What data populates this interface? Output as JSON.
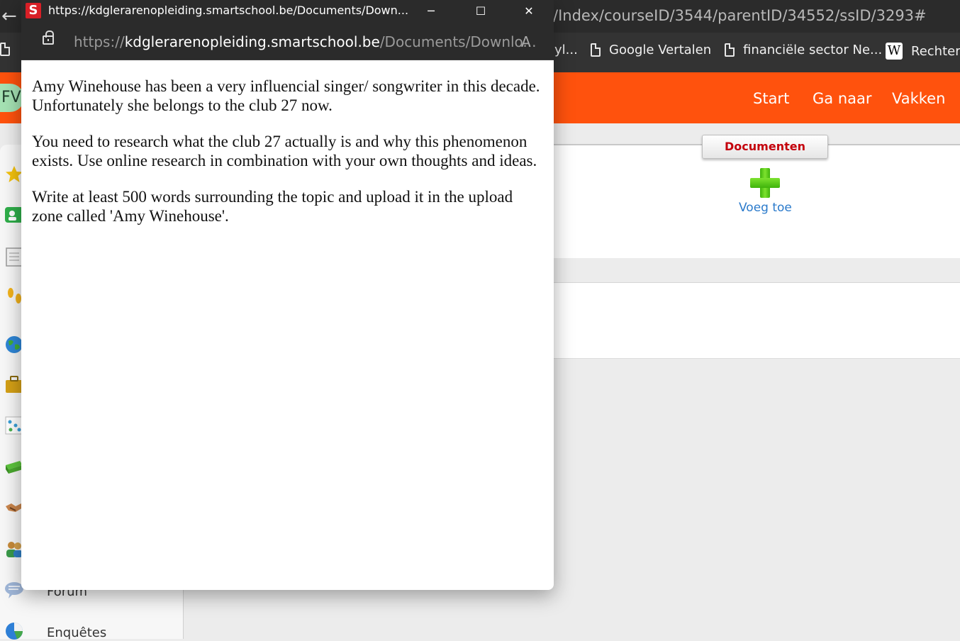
{
  "background": {
    "url_fragment": "/Index/courseID/3544/parentID/34552/ssID/3293#",
    "favorites": [
      {
        "label": "yl...",
        "icon": "document-icon"
      },
      {
        "label": "Google Vertalen",
        "icon": "document-icon"
      },
      {
        "label": "financiële sector Ne...",
        "icon": "document-icon"
      },
      {
        "label": "Rechterli",
        "icon": "wikipedia-icon"
      }
    ],
    "avatar_initials": "FV",
    "nav": {
      "start": "Start",
      "ga_naar": "Ga naar",
      "vakken": "Vakken"
    },
    "documents_tab": "Documenten",
    "add_label": "Voeg toe",
    "sidebar": {
      "forum": "Forum",
      "enquetes": "Enquêtes"
    },
    "colors": {
      "brand_orange": "#ff520d",
      "tab_red": "#c4000c",
      "link_blue": "#2a7acb"
    }
  },
  "popup": {
    "favicon_letter": "S",
    "title": "https://kdglerarenopleiding.smartschool.be/Documents/Down...",
    "url_scheme": "https://",
    "url_host": "kdglerarenopleiding.smartschool.be",
    "url_path": "/Documents/Downlo...",
    "read_aloud_glyph": "A",
    "window_buttons": {
      "minimize": "─",
      "maximize": "☐",
      "close": "✕"
    },
    "paragraphs": [
      "Amy Winehouse has been a very influencial singer/ songwriter in this decade. Unfortunately she belongs to the club 27 now.",
      "You need to research what the club 27 actually is and why this phenomenon exists. Use online research in combination with your own thoughts and ideas.",
      "Write at least 500 words surrounding the topic and upload it in the upload zone called 'Amy Winehouse'."
    ]
  }
}
